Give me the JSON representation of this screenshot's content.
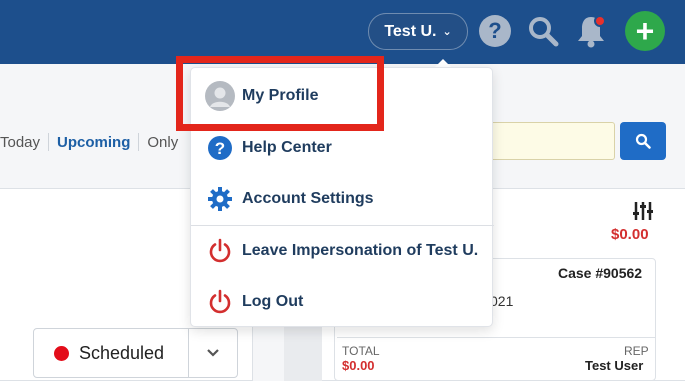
{
  "header": {
    "user_label": "Test U.",
    "icons": [
      "help-icon",
      "search-icon",
      "bell-icon",
      "add-icon"
    ],
    "add_symbol": "+"
  },
  "filters": {
    "items": [
      "Today",
      "Upcoming",
      "Only"
    ],
    "active": "Upcoming"
  },
  "status": {
    "label": "Scheduled",
    "color": "#e30d1a"
  },
  "summary": {
    "total": "$0.00"
  },
  "case_card": {
    "case_number": "Case #90562",
    "partial_date": "021",
    "total_label": "TOTAL",
    "total_value": "$0.00",
    "rep_label": "REP",
    "rep_value": "Test User"
  },
  "user_menu": {
    "items": [
      {
        "label": "My Profile",
        "icon": "avatar-icon"
      },
      {
        "label": "Help Center",
        "icon": "help-icon"
      },
      {
        "label": "Account Settings",
        "icon": "gear-icon"
      },
      {
        "label": "Leave Impersonation of Test U.",
        "icon": "power-icon"
      },
      {
        "label": "Log Out",
        "icon": "power-icon"
      }
    ]
  },
  "colors": {
    "header_bg": "#1d4f8c",
    "accent_blue": "#1f6cc6",
    "add_green": "#2ea84b",
    "danger_red": "#d32f2f",
    "highlight_red": "#e3261b"
  }
}
